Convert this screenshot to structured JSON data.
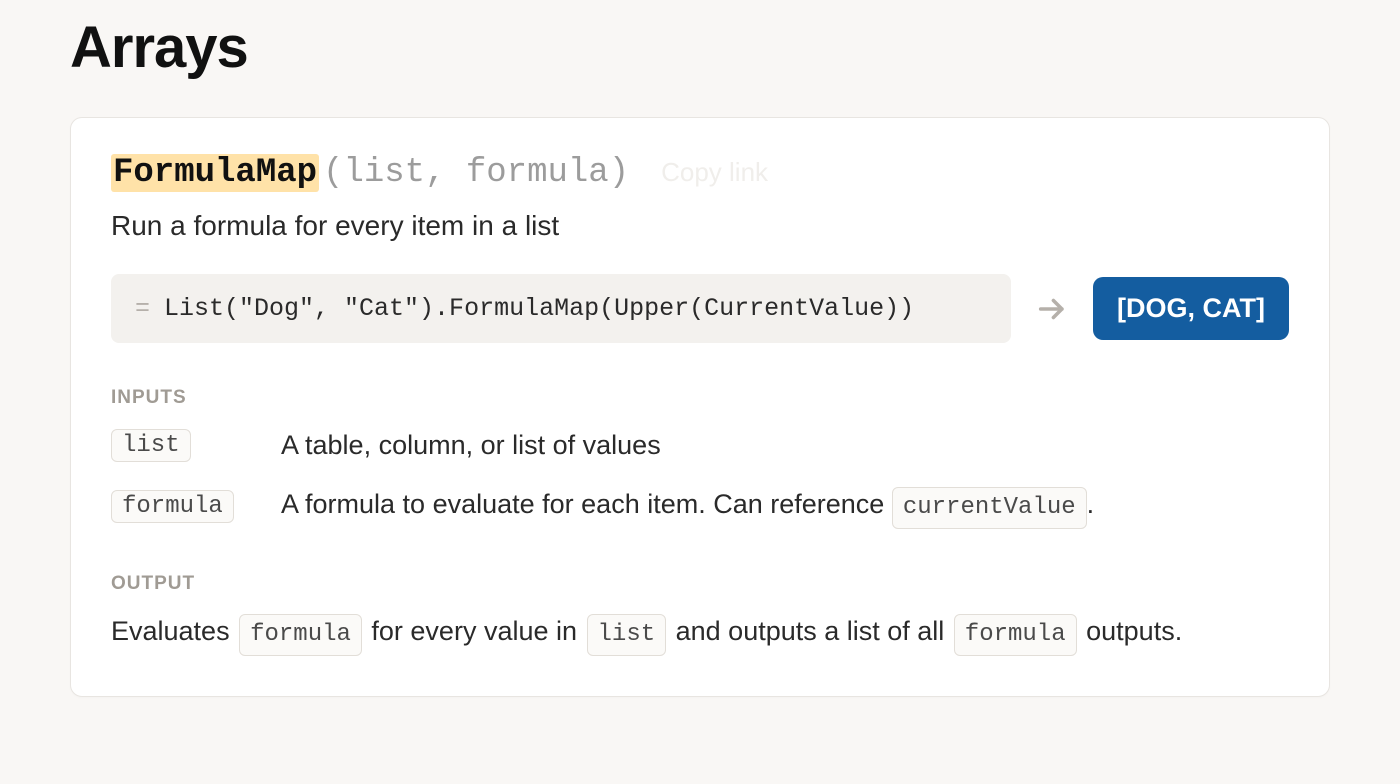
{
  "pageTitle": "Arrays",
  "function": {
    "name": "FormulaMap",
    "paramsDisplay": "(list, formula)",
    "copyLinkLabel": "Copy link",
    "description": "Run a formula for every item in a list"
  },
  "example": {
    "code": "List(\"Dog\", \"Cat\").FormulaMap(Upper(CurrentValue))",
    "result": "[DOG, CAT]"
  },
  "inputsLabel": "INPUTS",
  "inputs": [
    {
      "name": "list",
      "desc": "A table, column, or list of values"
    },
    {
      "name": "formula",
      "descPrefix": "A formula to evaluate for each item. Can reference ",
      "ref": "currentValue",
      "descSuffix": "."
    }
  ],
  "outputLabel": "OUTPUT",
  "output": {
    "t1": "Evaluates ",
    "k1": "formula",
    "t2": " for every value in ",
    "k2": "list",
    "t3": " and outputs a list of all ",
    "k3": "formula",
    "t4": " outputs."
  }
}
